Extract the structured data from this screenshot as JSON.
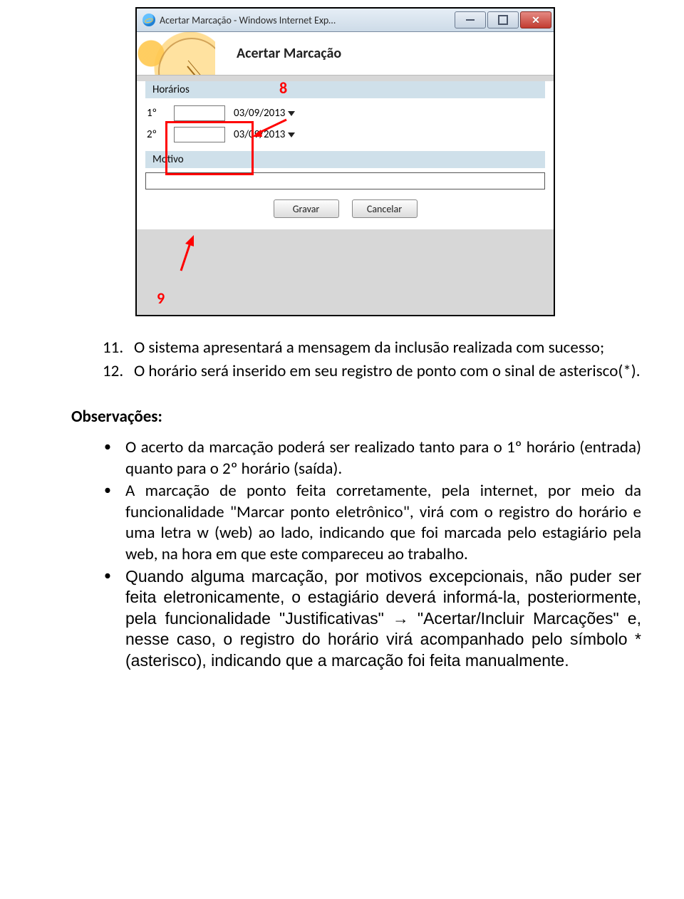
{
  "window": {
    "title": "Acertar Marcação - Windows Internet Exp…"
  },
  "banner": {
    "title": "Acertar Marcação"
  },
  "form": {
    "horarios_label": "Horários",
    "rows": [
      {
        "ord": "1º",
        "date": "03/09/2013"
      },
      {
        "ord": "2º",
        "date": "03/09/2013"
      }
    ],
    "motivo_label": "Motivo",
    "save_label": "Gravar",
    "cancel_label": "Cancelar"
  },
  "callouts": {
    "c8": "8",
    "c9": "9"
  },
  "doc": {
    "items": [
      {
        "num": "11.",
        "text": "O sistema apresentará a mensagem da inclusão realizada com sucesso;"
      },
      {
        "num": "12.",
        "text": "O horário será inserido em seu registro de ponto com o sinal de asterisco(*)."
      }
    ],
    "obs_label": "Observações:",
    "bullets": [
      "O acerto da marcação poderá ser realizado tanto para o 1º horário (entrada) quanto para o 2º horário (saída).",
      "A marcação de ponto feita corretamente, pela internet, por meio da funcionalidade \"Marcar ponto eletrônico\", virá com o registro do horário e uma letra w (web) ao lado, indicando que foi marcada pelo estagiário pela web, na hora em que este compareceu ao trabalho.",
      "Quando alguma marcação, por motivos excepcionais, não puder ser feita eletronicamente, o estagiário deverá informá-la, posteriormente, pela funcionalidade \"Justificativas\" → \"Acertar/Incluir Marcações\" e, nesse caso, o registro do horário virá acompanhado pelo símbolo * (asterisco), indicando que a marcação foi feita manualmente."
    ]
  }
}
